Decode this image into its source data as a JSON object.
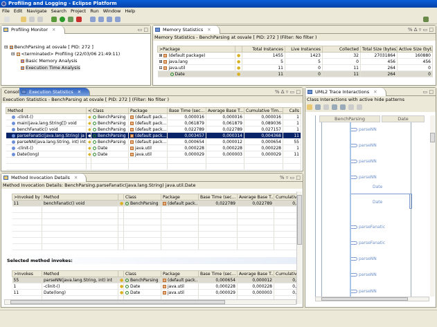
{
  "window": {
    "title": "Profiling and Logging - Eclipse Platform"
  },
  "menu": [
    "File",
    "Edit",
    "Navigate",
    "Search",
    "Project",
    "Run",
    "Window",
    "Help"
  ],
  "profiling_monitor": {
    "tab": "Profiling Monitor",
    "tree": [
      "BenchParsing at osvale [ PID: 272 ]",
      "<terminated> Profiling (22/03/06 21:49:11)",
      "Basic Memory Analysis",
      "Execution Time Analysis"
    ]
  },
  "memory": {
    "tab": "Memory Statistics",
    "subtitle": "Memory Statistics - BenchParsing at osvale [ PID: 272 ]  (Filter: No filter )",
    "columns": [
      ">Package",
      "",
      "Total Instances",
      "Live Instances",
      "Collected",
      "Total Size (bytes)",
      "Active Size (byt..."
    ],
    "rows": [
      [
        "(default package)",
        "1455",
        "1423",
        "32",
        "27031864",
        "160880"
      ],
      [
        "java.lang",
        "5",
        "5",
        "0",
        "456",
        "456"
      ],
      [
        "java.util",
        "11",
        "0",
        "11",
        "264",
        "0"
      ],
      [
        "Date",
        "11",
        "0",
        "11",
        "264",
        "0"
      ]
    ]
  },
  "exec": {
    "console_tab": "Console",
    "tab": "Execution Statistics",
    "subtitle": "Execution Statistics - BenchParsing at osvale [ PID: 272 ]  (Filter: No filter )",
    "columns": [
      "Method",
      "<",
      "Class",
      "Package",
      "Base Time (sec...",
      "Average Base T...",
      "Cumulative Tim...",
      "Calls"
    ],
    "rows": [
      [
        "-clinit-()",
        "BenchParsing",
        "(default pack...",
        "0,000016",
        "0,000016",
        "0,000016",
        "1"
      ],
      [
        "main(java.lang.String[]) void",
        "BenchParsing",
        "(default pack...",
        "0,061879",
        "0,061879",
        "0,089036",
        "1"
      ],
      [
        "benchFanatic() void",
        "BenchParsing",
        "(default pack...",
        "0,022789",
        "0,022789",
        "0,027157",
        "1"
      ],
      [
        "parseFanatic(java.lang.String) ja",
        "BenchParsing",
        "(default pack...",
        "0,003457",
        "0,000314",
        "0,004368",
        "11"
      ],
      [
        "parseNN(java.lang.String, int) int",
        "BenchParsing",
        "(default pack...",
        "0,000654",
        "0,000012",
        "0,000654",
        "55"
      ],
      [
        "-clinit-()",
        "Date",
        "java.util",
        "0,000228",
        "0,000228",
        "0,000228",
        "1"
      ],
      [
        "Date(long)",
        "Date",
        "java.util",
        "0,000029",
        "0,000003",
        "0,000029",
        "11"
      ]
    ]
  },
  "invocation": {
    "tab": "Method Invocation Details",
    "subtitle": "Method Invocation Details: BenchParsing.parseFanatic(java.lang.String) java.util.Date",
    "invoked_columns": [
      ">Invoked by",
      "Method",
      "",
      "Class",
      "Package",
      "Base Time (sec...",
      "Average Base T...",
      "Cumulative"
    ],
    "invoked_rows": [
      [
        "11",
        "benchFanatic() void",
        "BenchParsing",
        "(default pack...",
        "0,022789",
        "0,022789",
        "0,"
      ]
    ],
    "section_label": "Selected method invokes:",
    "invokes_columns": [
      ">Invokes",
      "Method",
      "",
      "Class",
      "Package",
      "Base Time (sec...",
      "Average Base T...",
      "Cumulative"
    ],
    "invokes_rows": [
      [
        "55",
        "parseNN(java.lang.String, int) int",
        "BenchParsing",
        "(default pack...",
        "0,000654",
        "0,000012",
        "0,"
      ],
      [
        "1",
        "-clinit-()",
        "Date",
        "java.util",
        "0,000228",
        "0,000228",
        "0,"
      ],
      [
        "11",
        "Date(long)",
        "Date",
        "java.util",
        "0,000029",
        "0,000003",
        "0,"
      ]
    ]
  },
  "uml": {
    "tab": "UML2 Trace Interactions",
    "subtitle": "Class Interactions with active hide patterns",
    "lifelines": [
      "BenchParsing",
      "Date"
    ],
    "messages": [
      "parseNN",
      "parseNN",
      "parseNN",
      "parseNN",
      "Date",
      "Date",
      "parseFanatic",
      "parseFanatic",
      "parseNN",
      "parseNN",
      "parseNN"
    ]
  }
}
